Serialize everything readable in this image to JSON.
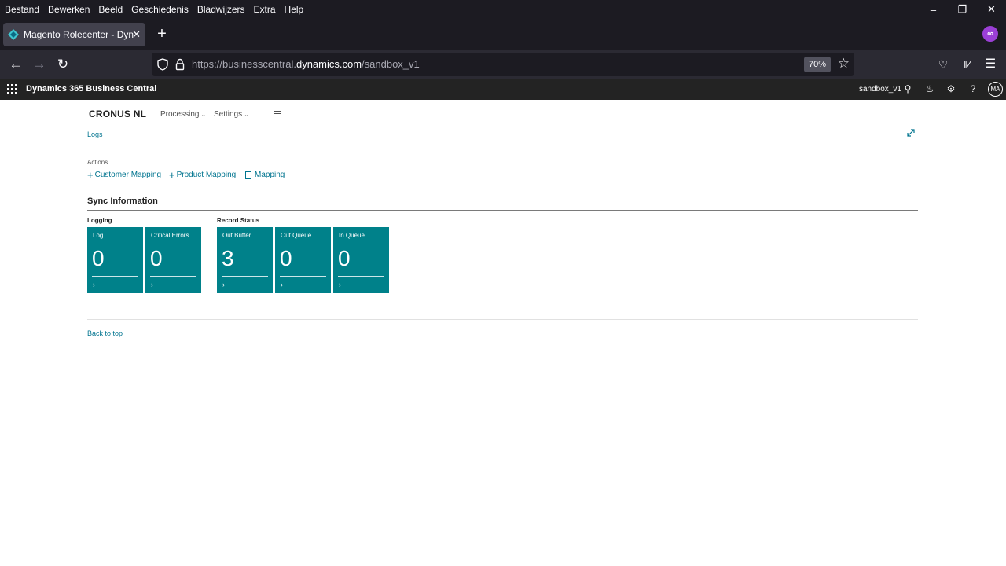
{
  "browser": {
    "menu": [
      "Bestand",
      "Bewerken",
      "Beeld",
      "Geschiedenis",
      "Bladwijzers",
      "Extra",
      "Help"
    ],
    "tab_title": "Magento Rolecenter - Dynamics",
    "url_prefix": "https://businesscentral.",
    "url_host": "dynamics.com",
    "url_path": "/sandbox_v1",
    "zoom": "70%"
  },
  "bc": {
    "app_title": "Dynamics 365 Business Central",
    "environment": "sandbox_v1",
    "avatar_initials": "MA"
  },
  "page": {
    "company": "CRONUS NL",
    "menus": [
      {
        "label": "Processing"
      },
      {
        "label": "Settings"
      }
    ],
    "logs_link": "Logs",
    "actions_label": "Actions",
    "actions": [
      {
        "label": "Customer Mapping"
      },
      {
        "label": "Product Mapping"
      },
      {
        "label": "Mapping"
      }
    ],
    "section_title": "Sync Information",
    "groups": [
      {
        "label": "Logging",
        "tiles": [
          {
            "label": "Log",
            "value": "0"
          },
          {
            "label": "Critical Errors",
            "value": "0"
          }
        ]
      },
      {
        "label": "Record Status",
        "tiles": [
          {
            "label": "Out Buffer",
            "value": "3"
          },
          {
            "label": "Out Queue",
            "value": "0"
          },
          {
            "label": "In Queue",
            "value": "0"
          }
        ]
      }
    ],
    "back_to_top": "Back to top"
  },
  "colors": {
    "tile": "#00818a",
    "link": "#00748f",
    "bc_header": "#232323"
  }
}
